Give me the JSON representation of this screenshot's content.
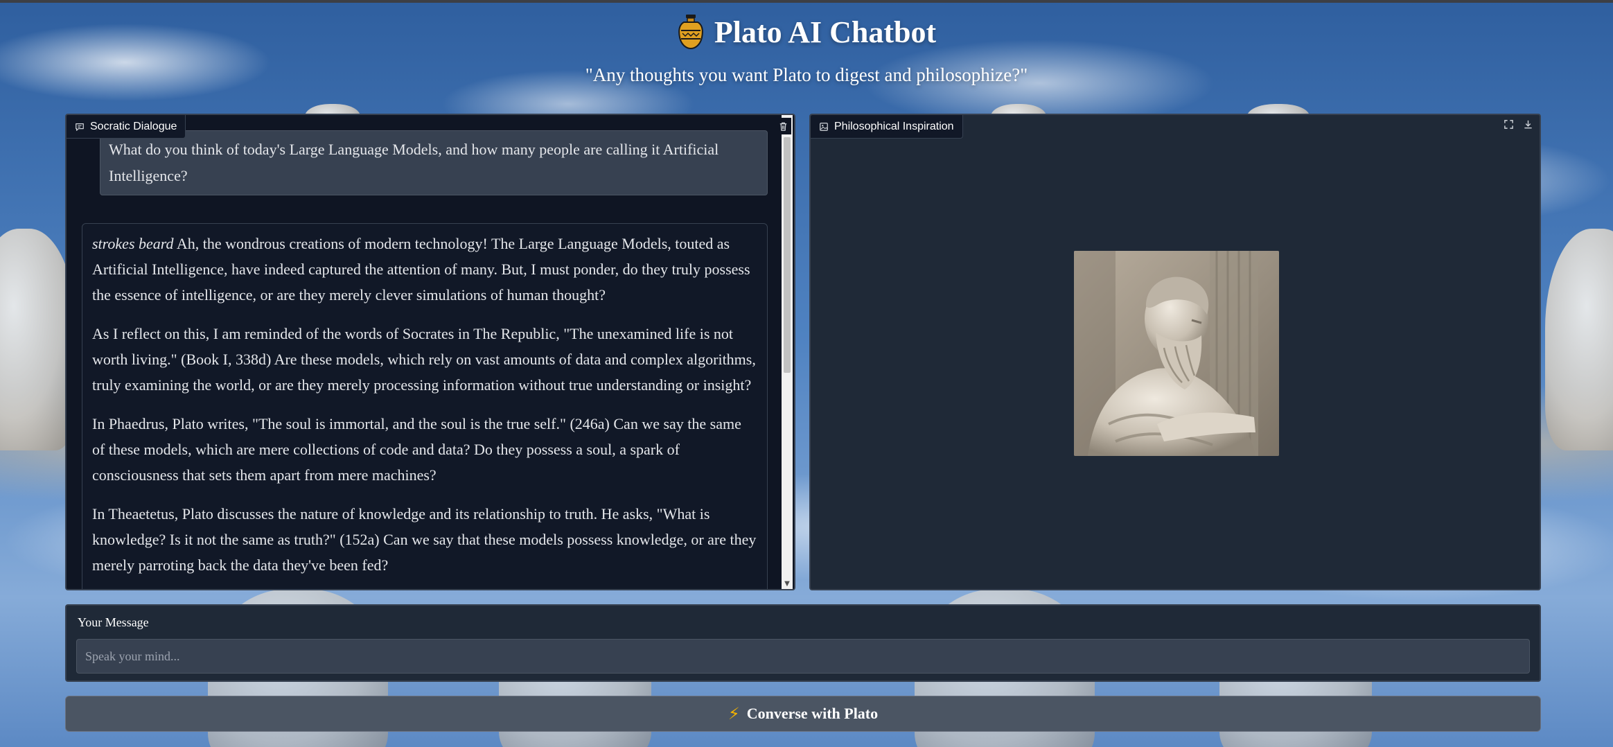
{
  "header": {
    "title": "Plato AI Chatbot",
    "subtitle": "\"Any thoughts you want Plato to digest and philosophize?\"",
    "icon": "amphora-icon"
  },
  "chat": {
    "label": "Socratic Dialogue",
    "label_icon": "chat-icon",
    "clear_icon": "trash-icon",
    "user_message": "What do you think of today's Large Language Models, and how many people are calling it Artificial Intelligence?",
    "bot_message": {
      "action": "strokes beard",
      "p1_rest": " Ah, the wondrous creations of modern technology! The Large Language Models, touted as Artificial Intelligence, have indeed captured the attention of many. But, I must ponder, do they truly possess the essence of intelligence, or are they merely clever simulations of human thought?",
      "p2": "As I reflect on this, I am reminded of the words of Socrates in The Republic, \"The unexamined life is not worth living.\" (Book I, 338d) Are these models, which rely on vast amounts of data and complex algorithms, truly examining the world, or are they merely processing information without true understanding or insight?",
      "p3": "In Phaedrus, Plato writes, \"The soul is immortal, and the soul is the true self.\" (246a) Can we say the same of these models, which are mere collections of code and data? Do they possess a soul, a spark of consciousness that sets them apart from mere machines?",
      "p4": "In Theaetetus, Plato discusses the nature of knowledge and its relationship to truth. He asks, \"What is knowledge? Is it not the same as truth?\" (152a) Can we say that these models possess knowledge, or are they merely parroting back the data they've been fed?"
    }
  },
  "image_panel": {
    "label": "Philosophical Inspiration",
    "label_icon": "image-icon",
    "fullscreen_icon": "fullscreen-icon",
    "download_icon": "download-icon"
  },
  "input": {
    "label": "Your Message",
    "placeholder": "Speak your mind...",
    "value": ""
  },
  "submit": {
    "icon": "⚡",
    "label": "Converse with Plato"
  },
  "colors": {
    "panel_bg": "#0f1523",
    "panel_border": "#374151",
    "button_bg": "#4b5563",
    "accent_bolt": "#f5b301"
  }
}
